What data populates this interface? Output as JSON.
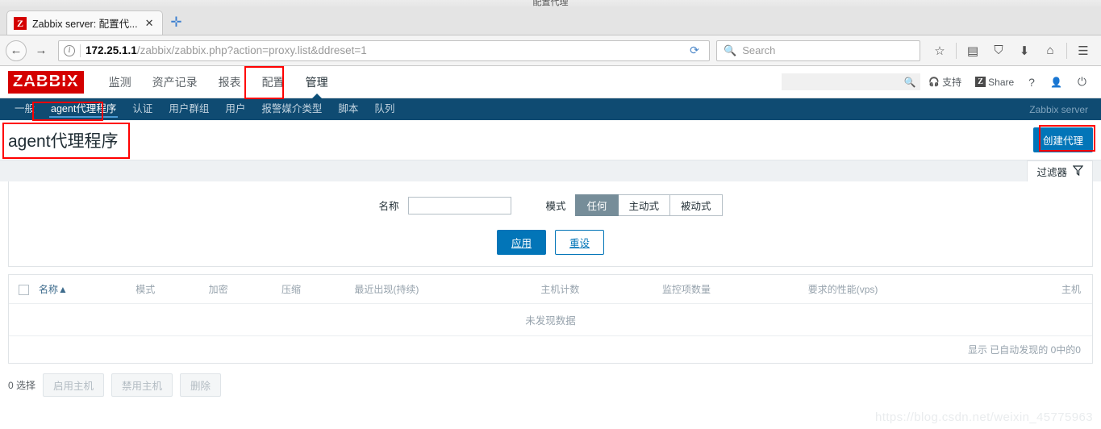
{
  "window": {
    "clipped_title": "配置代理"
  },
  "browser": {
    "tab": {
      "favicon_letter": "Z",
      "title": "Zabbix server: 配置代...",
      "close_label": "✕"
    },
    "newtab_label": "✛",
    "nav": {
      "back_label": "←",
      "forward_label": "→",
      "info_label": "i",
      "reload_label": "⟳"
    },
    "url": {
      "host": "172.25.1.1",
      "path": "/zabbix/zabbix.php?action=proxy.list&ddreset=1"
    },
    "search": {
      "placeholder": "Search",
      "icon": "search-icon",
      "glyph": "🔍"
    },
    "toolbar_icons": [
      {
        "name": "bookmark-star-icon",
        "glyph": "☆"
      },
      {
        "name": "library-icon",
        "glyph": "▤"
      },
      {
        "name": "pocket-icon",
        "glyph": "⛉"
      },
      {
        "name": "downloads-icon",
        "glyph": "⬇"
      },
      {
        "name": "home-icon",
        "glyph": "⌂"
      },
      {
        "name": "hamburger-menu-icon",
        "glyph": "☰"
      }
    ]
  },
  "zabbix": {
    "logo": "ZABBIX",
    "main_nav": [
      {
        "label": "监测",
        "active": false
      },
      {
        "label": "资产记录",
        "active": false
      },
      {
        "label": "报表",
        "active": false
      },
      {
        "label": "配置",
        "active": false
      },
      {
        "label": "管理",
        "active": true
      }
    ],
    "header_right": {
      "search_value": "",
      "search_icon_glyph": "🔍",
      "support_label": "支持",
      "support_icon_glyph": "🎧",
      "share_label": "Share",
      "share_icon_letter": "Z",
      "help_label": "?",
      "user_icon_glyph": "👤",
      "signout_icon_glyph": "⏻"
    },
    "sub_nav": [
      {
        "label": "一般",
        "active": false
      },
      {
        "label": "agent代理程序",
        "active": true
      },
      {
        "label": "认证",
        "active": false
      },
      {
        "label": "用户群组",
        "active": false
      },
      {
        "label": "用户",
        "active": false
      },
      {
        "label": "报警媒介类型",
        "active": false
      },
      {
        "label": "脚本",
        "active": false
      },
      {
        "label": "队列",
        "active": false
      }
    ],
    "server_label": "Zabbix server",
    "page_title": "agent代理程序",
    "create_button": "创建代理",
    "filter_tab": {
      "label": "过滤器",
      "icon": "filter-funnel-icon",
      "glyph": "▽"
    },
    "filter": {
      "name_label": "名称",
      "name_value": "",
      "mode_label": "模式",
      "mode_options": [
        {
          "label": "任何",
          "selected": true
        },
        {
          "label": "主动式",
          "selected": false
        },
        {
          "label": "被动式",
          "selected": false
        }
      ],
      "apply_button": "应用",
      "reset_button": "重设"
    },
    "table": {
      "columns": [
        "名称▲",
        "模式",
        "加密",
        "压缩",
        "最近出现(持续)",
        "主机计数",
        "监控项数量",
        "要求的性能(vps)",
        "主机"
      ],
      "rows": [],
      "empty_message": "未发现数据",
      "footer_text": "显示 已自动发现的 0中的0"
    },
    "bottom_bar": {
      "selected_text": "0 选择",
      "buttons": [
        "启用主机",
        "禁用主机",
        "删除"
      ]
    }
  },
  "watermark": "https://blog.csdn.net/weixin_45775963",
  "colors": {
    "brand_red": "#d40000",
    "nav_dark_blue": "#0f4b72",
    "accent_blue": "#0275b8",
    "annotation_red": "#ff0000"
  }
}
